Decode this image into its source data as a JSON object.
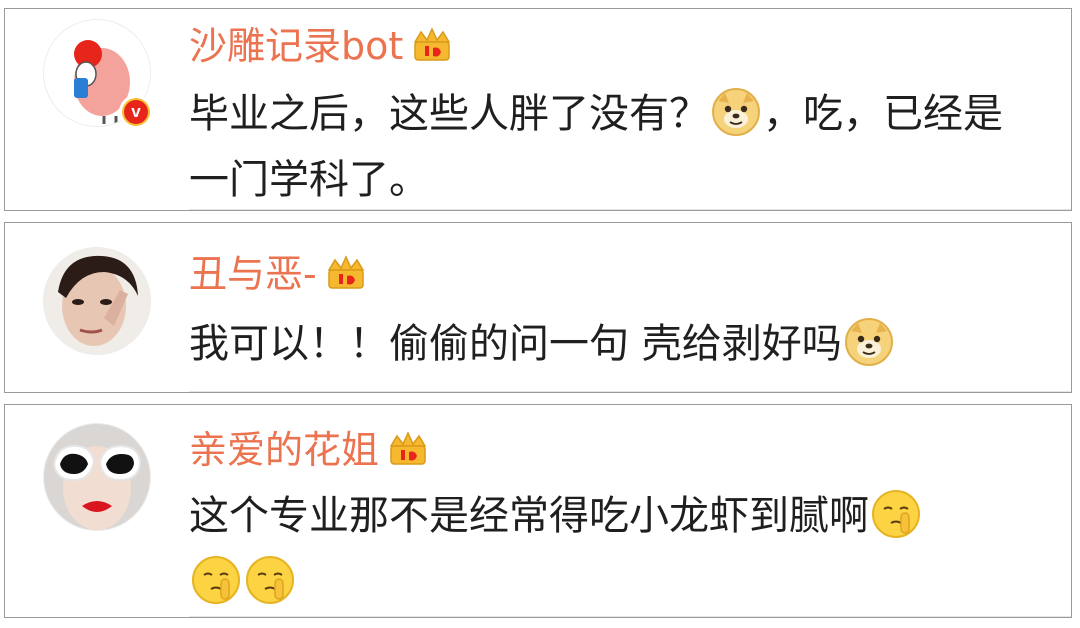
{
  "comments": [
    {
      "username": "沙雕记录bot",
      "verified": true,
      "text_parts": [
        "毕业之后，这些人胖了没有？",
        "，吃，已经是一门学科了。"
      ],
      "emoji": "doge-emoji"
    },
    {
      "username": "丑与恶-",
      "verified": false,
      "text_parts": [
        "我可以！！偷偷的问一句 壳给剥好吗"
      ],
      "emoji": "doge-emoji"
    },
    {
      "username": "亲爱的花姐",
      "verified": false,
      "text_parts": [
        "这个专业那不是经常得吃小龙虾到腻啊"
      ],
      "emoji": "shush-emoji"
    }
  ],
  "icons": {
    "crown": "crown-member-icon",
    "verified": "verified-v-icon",
    "verified_letter": "v"
  },
  "colors": {
    "username": "#eb7350",
    "text": "#1f1f1f",
    "card_border": "#9a9a9a",
    "verified_red": "#e8251a",
    "crown_gold": "#f5b82e"
  }
}
